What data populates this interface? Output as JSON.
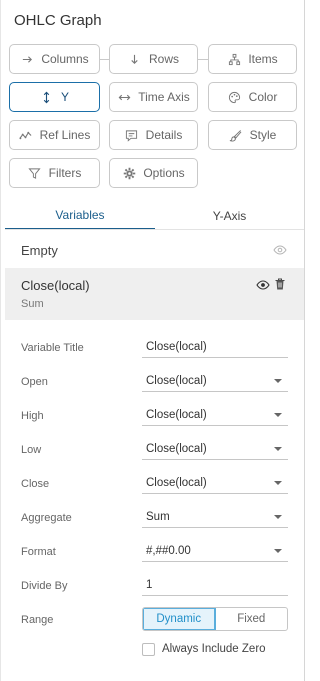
{
  "panel": {
    "title": "OHLC Graph"
  },
  "chips": {
    "columns": "Columns",
    "rows": "Rows",
    "items": "Items",
    "y": "Y",
    "time_axis": "Time Axis",
    "color": "Color",
    "ref_lines": "Ref Lines",
    "details": "Details",
    "style": "Style",
    "filters": "Filters",
    "options": "Options"
  },
  "tabs": {
    "variables": "Variables",
    "y_axis": "Y-Axis"
  },
  "variables": {
    "empty_label": "Empty",
    "selected": {
      "name": "Close(local)",
      "aggregation": "Sum"
    }
  },
  "fields": {
    "variable_title": {
      "label": "Variable Title",
      "value": "Close(local)"
    },
    "open": {
      "label": "Open",
      "value": "Close(local)"
    },
    "high": {
      "label": "High",
      "value": "Close(local)"
    },
    "low": {
      "label": "Low",
      "value": "Close(local)"
    },
    "close": {
      "label": "Close",
      "value": "Close(local)"
    },
    "aggregate": {
      "label": "Aggregate",
      "value": "Sum"
    },
    "format": {
      "label": "Format",
      "value": "#,##0.00"
    },
    "divide_by": {
      "label": "Divide By",
      "value": "1"
    },
    "range": {
      "label": "Range",
      "options": [
        "Dynamic",
        "Fixed"
      ],
      "selected": "Dynamic"
    },
    "always_include_zero": {
      "label": "Always Include Zero",
      "checked": false
    }
  },
  "colors": {
    "accent": "#1b5e8c",
    "active_chip": "#1b6fa8",
    "segment_on": "#2390c9"
  }
}
